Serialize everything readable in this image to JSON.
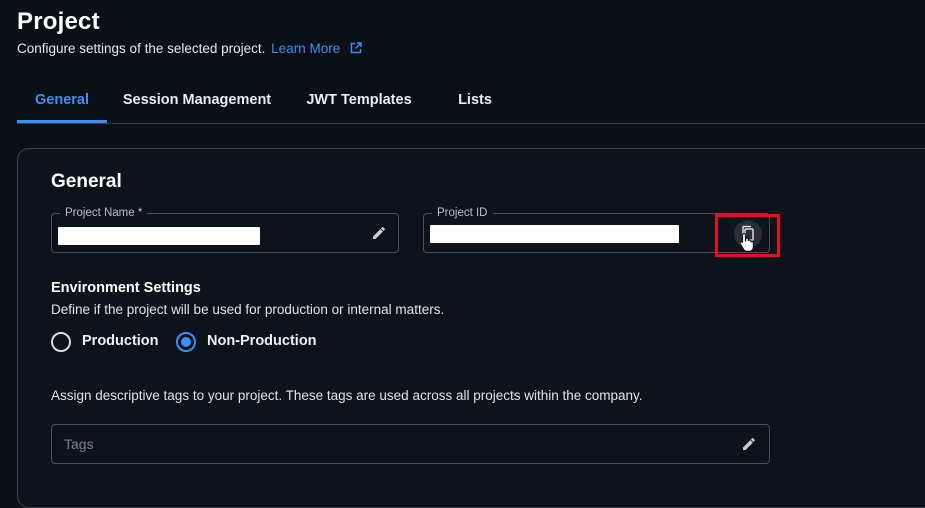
{
  "header": {
    "title": "Project",
    "subtitle": "Configure settings of the selected project.",
    "learn_more": "Learn More"
  },
  "tabs": [
    {
      "label": "General",
      "active": true
    },
    {
      "label": "Session Management",
      "active": false
    },
    {
      "label": "JWT Templates",
      "active": false
    },
    {
      "label": "Lists",
      "active": false
    }
  ],
  "general": {
    "title": "General",
    "project_name": {
      "label": "Project Name *",
      "value": "",
      "redacted": true
    },
    "project_id": {
      "label": "Project ID",
      "value": "",
      "redacted": true
    },
    "environment": {
      "title": "Environment Settings",
      "description": "Define if the project will be used for production or internal matters.",
      "options": [
        {
          "label": "Production",
          "selected": false
        },
        {
          "label": "Non-Production",
          "selected": true
        }
      ]
    },
    "tags": {
      "description": "Assign descriptive tags to your project. These tags are used across all projects within the company.",
      "placeholder": "Tags",
      "value": ""
    }
  },
  "icons": {
    "external_link": "external-link-icon",
    "edit": "pencil-icon",
    "copy": "copy-icon",
    "cursor": "hand-pointer-cursor"
  },
  "colors": {
    "background": "#0b0f16",
    "accent": "#3d8ef5",
    "highlight": "#e0121b"
  }
}
